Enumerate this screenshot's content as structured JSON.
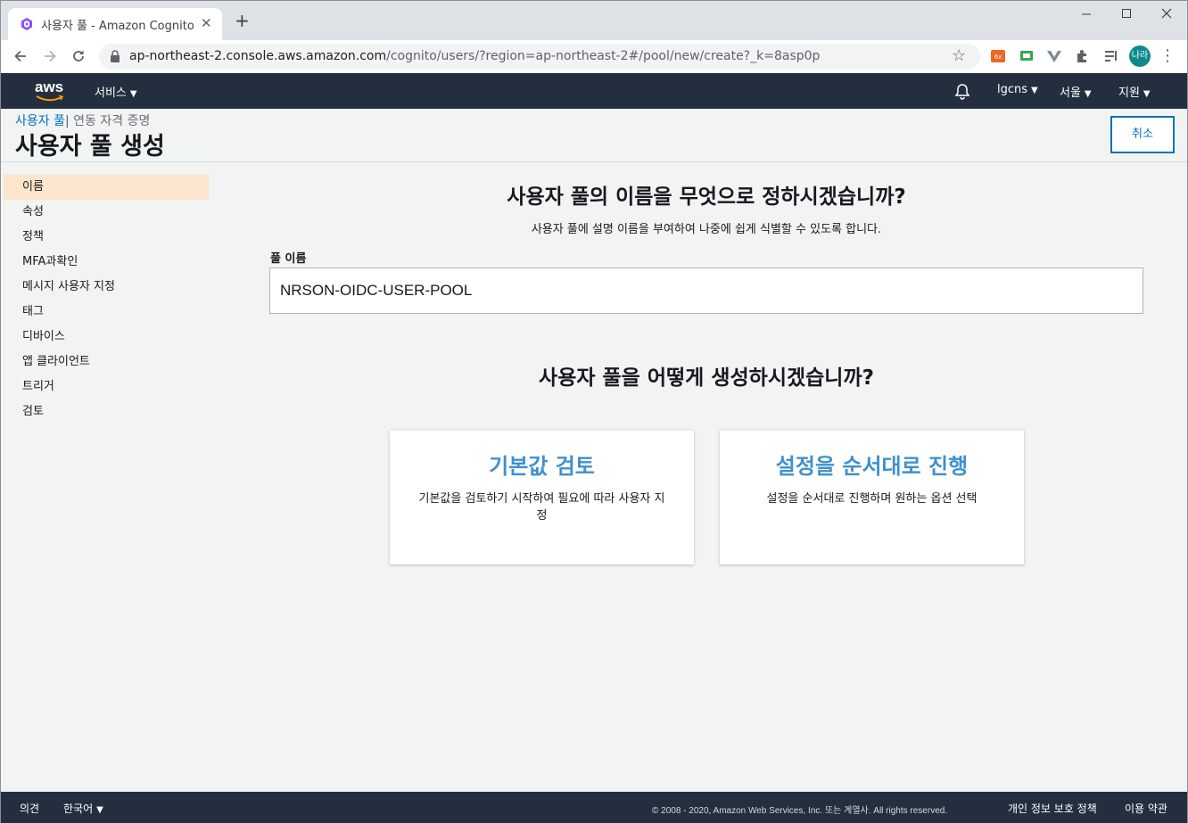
{
  "browser": {
    "tab_title": "사용자 풀 - Amazon Cognito",
    "tab_close": "✕",
    "new_tab": "+",
    "url_host": "ap-northeast-2.console.aws.amazon.com",
    "url_path": "/cognito/users/?region=ap-northeast-2#/pool/new/create?_k=8asp0p",
    "profile_label": "나라",
    "window_controls": [
      "minimize",
      "maximize",
      "close"
    ]
  },
  "aws_header": {
    "logo": "aws",
    "services_label": "서비스",
    "account_label": "lgcns",
    "region_label": "서울",
    "support_label": "지원"
  },
  "page": {
    "breadcrumb_user_pools": "사용자 풀",
    "breadcrumb_separator": "|",
    "breadcrumb_federated": "연동 자격 증명",
    "title": "사용자 풀 생성",
    "cancel_label": "취소"
  },
  "sidebar": {
    "items": [
      {
        "label": "이름",
        "active": true
      },
      {
        "label": "속성"
      },
      {
        "label": "정책"
      },
      {
        "label": "MFA과확인"
      },
      {
        "label": "메시지 사용자 지정"
      },
      {
        "label": "태그"
      },
      {
        "label": "디바이스"
      },
      {
        "label": "앱 클라이언트"
      },
      {
        "label": "트리거"
      },
      {
        "label": "검토"
      }
    ]
  },
  "main": {
    "name_question": "사용자 풀의 이름을 무엇으로 정하시겠습니까?",
    "name_hint": "사용자 풀에 설명 이름을 부여하여 나중에 쉽게 식별할 수 있도록 합니다.",
    "pool_name_label": "풀 이름",
    "pool_name_value": "NRSON-OIDC-USER-POOL",
    "create_question": "사용자 풀을 어떻게 생성하시겠습니까?",
    "options": [
      {
        "title": "기본값 검토",
        "description": "기본값을 검토하기 시작하여 필요에 따라 사용자 지정"
      },
      {
        "title": "설정을 순서대로 진행",
        "description": "설정을 순서대로 진행하며 원하는 옵션 선택"
      }
    ]
  },
  "footer": {
    "feedback": "의견",
    "language": "한국어",
    "copyright": "© 2008 - 2020, Amazon Web Services, Inc. 또는 계열사. All rights reserved.",
    "privacy": "개인 정보 보호 정책",
    "terms": "이용 약관"
  },
  "colors": {
    "aws_nav": "#232f3e",
    "link": "#0073bb",
    "card_title": "#3f91cc",
    "active_nav": "#fbe5cc",
    "aws_orange": "#ff9900"
  }
}
